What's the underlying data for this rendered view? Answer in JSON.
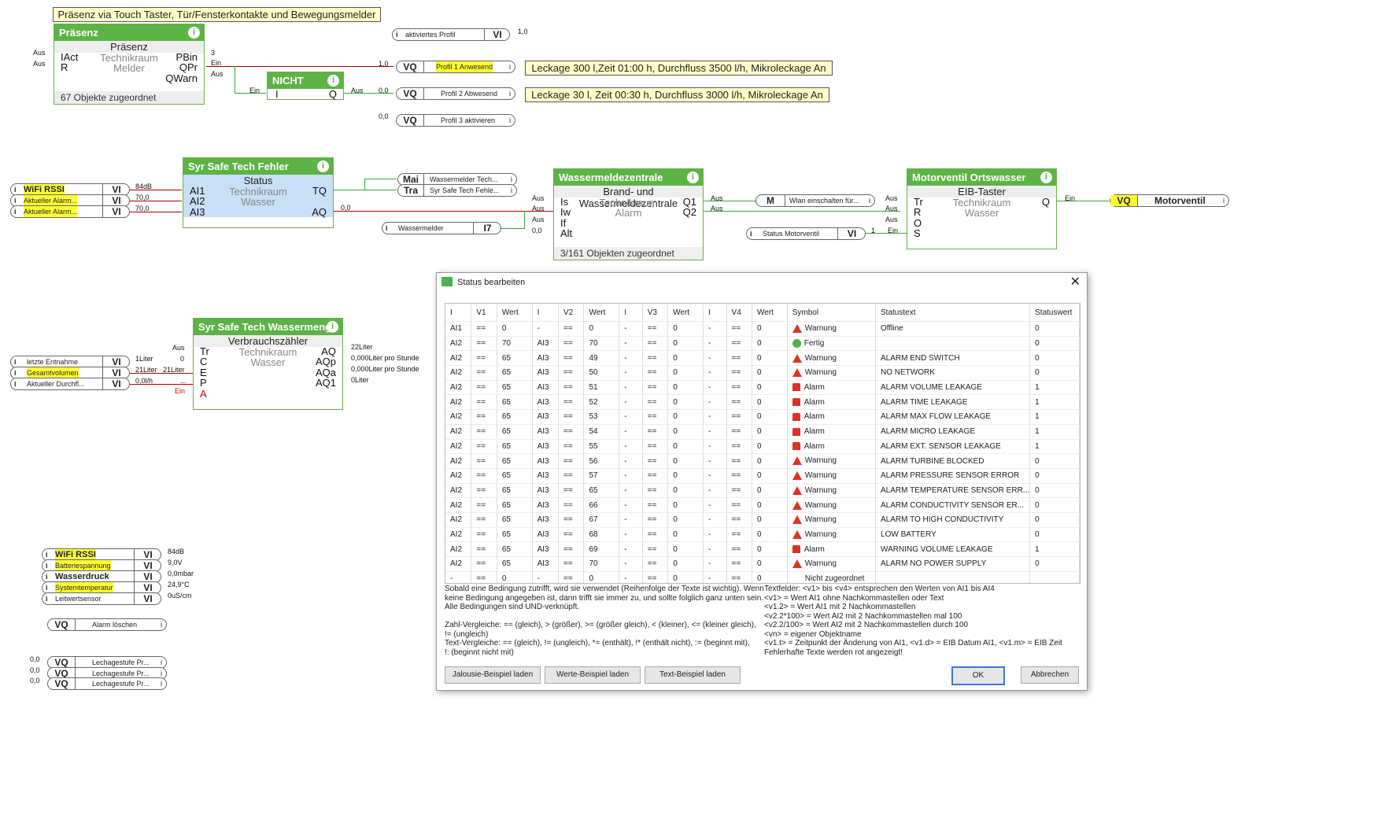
{
  "notes": {
    "top": "Präsenz via Touch Taster, Tür/Fensterkontakte und Bewegungsmelder",
    "leak1": "Leckage 300 l,Zeit 01:00 h, Durchfluss 3500 l/h, Mikroleckage An",
    "leak2": "Leckage 30 l, Zeit 00:30 h, Durchfluss 3000 l/h, Mikroleckage An"
  },
  "praesenz": {
    "title": "Präsenz",
    "sub": "Präsenz",
    "room": "Technikraum",
    "type": "Melder",
    "in1": "IAct",
    "in2": "R",
    "out1": "PBin",
    "out2": "QPr",
    "out3": "QWarn",
    "footer": "67 Objekte zugeordnet",
    "lbl_aus1": "Aus",
    "lbl_aus2": "Aus",
    "val_pbin": "3",
    "val_ein": "Ein",
    "val_aus": "Aus"
  },
  "nicht": {
    "title": "NICHT",
    "in": "I",
    "out": "Q",
    "lbl_in": "Ein",
    "lbl_out": "Aus",
    "val": "0,0"
  },
  "profiles": {
    "active": {
      "label": "aktiviertes Profil",
      "type": "VI",
      "value": "1,0"
    },
    "p1": {
      "label": "Profil 1 Anwesend",
      "type": "VQ",
      "value": "1,0"
    },
    "p2": {
      "label": "Profil 2 Abwesend",
      "type": "VQ",
      "value": "0,0"
    },
    "p3": {
      "label": "Profil 3 aktivieren",
      "type": "VQ",
      "value": "0,0"
    }
  },
  "fehler": {
    "title": "Syr Safe Tech Fehler",
    "sub": "Status",
    "room": "Technikraum",
    "type": "Wasser",
    "in1": "AI1",
    "in2": "AI2",
    "in3": "AI3",
    "out1": "TQ",
    "out2": "AQ",
    "inputs": [
      {
        "label": "WiFi RSSI",
        "type": "VI",
        "value": "84dB"
      },
      {
        "label": "Aktueller Alarm...",
        "type": "VI",
        "value": "70,0"
      },
      {
        "label": "Aktueller Alarm...",
        "type": "VI",
        "value": "70,0"
      }
    ],
    "out_val": "0,0",
    "mai": {
      "type": "Mai",
      "label": "Wassermelder Tech..."
    },
    "tra": {
      "type": "Tra",
      "label": "Syr Safe Tech Fehle..."
    },
    "wassermelder": {
      "label": "Wassermelder",
      "type": "I7"
    }
  },
  "zentrale": {
    "title": "Wassermeldezentrale",
    "sub": "Brand- und Wassermeldezentrale",
    "room": "Technikraum",
    "type": "Alarm",
    "in1": "Is",
    "in2": "Iw",
    "in3": "If",
    "in4": "Alt",
    "out1": "Q1",
    "out2": "Q2",
    "footer": "3/161 Objekten zugeordnet",
    "lbl": [
      "Aus",
      "Aus",
      "Aus",
      "0,0"
    ],
    "out_lbl": [
      "Aus",
      "Aus"
    ],
    "m": {
      "type": "M",
      "label": "Wlan einschalten für..."
    }
  },
  "motor": {
    "title": "Motorventil Ortswasser",
    "sub": "EIB-Taster",
    "room": "Technikraum",
    "type": "Wasser",
    "in1": "Tr",
    "in2": "R",
    "in3": "O",
    "in4": "S",
    "out": "Q",
    "lbl": [
      "Aus",
      "Aus",
      "Aus",
      "Ein"
    ],
    "out_lbl": "Ein",
    "status": {
      "label": "Status Motorventil",
      "type": "VI",
      "value": "1"
    },
    "vq": {
      "type": "VQ",
      "label": "Motorventil"
    }
  },
  "menge": {
    "title": "Syr Safe Tech Wassermenge",
    "sub": "Verbrauchszähler",
    "room": "Technikraum",
    "type": "Wasser",
    "in": [
      "Tr",
      "C",
      "E",
      "P",
      "A"
    ],
    "out": [
      "AQ",
      "AQp",
      "AQa",
      "AQ1"
    ],
    "out_vals": [
      "22Liter",
      "0,000Liter pro Stunde",
      "0,000Liter pro Stunde",
      "0Liter"
    ],
    "lbl_aus": "Aus",
    "lbl_ein": "Ein",
    "lbl_0": "0",
    "lbl_21": "21Liter",
    "lbl_dots": "...",
    "inputs": [
      {
        "label": "letzte Entnahme",
        "type": "VI",
        "value": "1Liter"
      },
      {
        "label": "Gesamtvolumen",
        "type": "VI",
        "value": "21Liter"
      },
      {
        "label": "Aktueller Durchfl...",
        "type": "VI",
        "value": "0,0l/h"
      }
    ]
  },
  "sensors": [
    {
      "label": "WiFi RSSI",
      "type": "VI",
      "value": "84dB"
    },
    {
      "label": "Batteriespannung",
      "type": "VI",
      "value": "9,0V"
    },
    {
      "label": "Wasserdruck",
      "type": "VI",
      "value": "0,0mbar"
    },
    {
      "label": "Systemtemperatur",
      "type": "VI",
      "value": "24,9°C"
    },
    {
      "label": "Leitwertsensor",
      "type": "VI",
      "value": "0uS/cm"
    }
  ],
  "alarm_loeschen": {
    "type": "VQ",
    "label": "Alarm löschen"
  },
  "lechage": [
    {
      "type": "VQ",
      "label": "Lechagestufe Pr...",
      "value": "0,0"
    },
    {
      "type": "VQ",
      "label": "Lechagestufe Pr...",
      "value": "0,0"
    },
    {
      "type": "VQ",
      "label": "Lechagestufe Pr...",
      "value": "0,0"
    }
  ],
  "dialog": {
    "title": "Status bearbeiten",
    "columns": [
      "I",
      "V1",
      "Wert",
      "I",
      "V2",
      "Wert",
      "I",
      "V3",
      "Wert",
      "I",
      "V4",
      "Wert",
      "Symbol",
      "Statustext",
      "Statuswert"
    ],
    "rows": [
      [
        "AI1",
        "==",
        "0",
        "-",
        "==",
        "0",
        "-",
        "==",
        "0",
        "-",
        "==",
        "0",
        "warn",
        "Warnung",
        "Offline",
        "0"
      ],
      [
        "AI2",
        "==",
        "70",
        "AI3",
        "==",
        "70",
        "-",
        "==",
        "0",
        "-",
        "==",
        "0",
        "ok",
        "Fertig",
        "",
        "0"
      ],
      [
        "AI2",
        "==",
        "65",
        "AI3",
        "==",
        "49",
        "-",
        "==",
        "0",
        "-",
        "==",
        "0",
        "warn",
        "Warnung",
        "ALARM END SWITCH",
        "0"
      ],
      [
        "AI2",
        "==",
        "65",
        "AI3",
        "==",
        "50",
        "-",
        "==",
        "0",
        "-",
        "==",
        "0",
        "warn",
        "Warnung",
        "NO NETWORK",
        "0"
      ],
      [
        "AI2",
        "==",
        "65",
        "AI3",
        "==",
        "51",
        "-",
        "==",
        "0",
        "-",
        "==",
        "0",
        "alarm",
        "Alarm",
        "ALARM VOLUME LEAKAGE",
        "1"
      ],
      [
        "AI2",
        "==",
        "65",
        "AI3",
        "==",
        "52",
        "-",
        "==",
        "0",
        "-",
        "==",
        "0",
        "alarm",
        "Alarm",
        "ALARM TIME LEAKAGE",
        "1"
      ],
      [
        "AI2",
        "==",
        "65",
        "AI3",
        "==",
        "53",
        "-",
        "==",
        "0",
        "-",
        "==",
        "0",
        "alarm",
        "Alarm",
        "ALARM MAX FLOW LEAKAGE",
        "1"
      ],
      [
        "AI2",
        "==",
        "65",
        "AI3",
        "==",
        "54",
        "-",
        "==",
        "0",
        "-",
        "==",
        "0",
        "alarm",
        "Alarm",
        "ALARM MICRO LEAKAGE",
        "1"
      ],
      [
        "AI2",
        "==",
        "65",
        "AI3",
        "==",
        "55",
        "-",
        "==",
        "0",
        "-",
        "==",
        "0",
        "alarm",
        "Alarm",
        "ALARM EXT. SENSOR LEAKAGE",
        "1"
      ],
      [
        "AI2",
        "==",
        "65",
        "AI3",
        "==",
        "56",
        "-",
        "==",
        "0",
        "-",
        "==",
        "0",
        "warn",
        "Warnung",
        "ALARM TURBINE BLOCKED",
        "0"
      ],
      [
        "AI2",
        "==",
        "65",
        "AI3",
        "==",
        "57",
        "-",
        "==",
        "0",
        "-",
        "==",
        "0",
        "warn",
        "Warnung",
        "ALARM PRESSURE SENSOR ERROR",
        "0"
      ],
      [
        "AI2",
        "==",
        "65",
        "AI3",
        "==",
        "65",
        "-",
        "==",
        "0",
        "-",
        "==",
        "0",
        "warn",
        "Warnung",
        "ALARM TEMPERATURE SENSOR ERR...",
        "0"
      ],
      [
        "AI2",
        "==",
        "65",
        "AI3",
        "==",
        "66",
        "-",
        "==",
        "0",
        "-",
        "==",
        "0",
        "warn",
        "Warnung",
        "ALARM CONDUCTIVITY SENSOR ER...",
        "0"
      ],
      [
        "AI2",
        "==",
        "65",
        "AI3",
        "==",
        "67",
        "-",
        "==",
        "0",
        "-",
        "==",
        "0",
        "warn",
        "Warnung",
        "ALARM TO HIGH CONDUCTIVITY",
        "0"
      ],
      [
        "AI2",
        "==",
        "65",
        "AI3",
        "==",
        "68",
        "-",
        "==",
        "0",
        "-",
        "==",
        "0",
        "warn",
        "Warnung",
        "LOW BATTERY",
        "0"
      ],
      [
        "AI2",
        "==",
        "65",
        "AI3",
        "==",
        "69",
        "-",
        "==",
        "0",
        "-",
        "==",
        "0",
        "alarm",
        "Alarm",
        "WARNING VOLUME LEAKAGE",
        "1"
      ],
      [
        "AI2",
        "==",
        "65",
        "AI3",
        "==",
        "70",
        "-",
        "==",
        "0",
        "-",
        "==",
        "0",
        "warn",
        "Warnung",
        "ALARM NO POWER SUPPLY",
        "0"
      ],
      [
        "-",
        "==",
        "0",
        "-",
        "==",
        "0",
        "-",
        "==",
        "0",
        "-",
        "==",
        "0",
        "none",
        "Nicht zugeordnet",
        "",
        ""
      ]
    ],
    "help_left": "Sobald eine Bedingung zutrifft, wird sie verwendet (Reihenfolge der Texte ist wichtig). Wenn\nkeine Bedingung angegeben ist, dann trifft sie immer zu, und sollte folglich ganz unten sein.\nAlle Bedingungen sind UND-verknüpft.\n\nZahl-Vergleiche: == (gleich), > (größer), >= (größer gleich), < (kleiner), <= (kleiner gleich),\n!= (ungleich)\nText-Vergleiche: == (gleich), != (ungleich), *= (enthält), !* (enthält nicht), := (beginnt mit),\n!: (beginnt nicht mit)",
    "help_right": "Textfelder: <v1> bis <v4> entsprechen den Werten von AI1 bis AI4\n<v1> = Wert AI1 ohne Nachkommastellen oder Text\n<v1.2> = Wert AI1 mit 2 Nachkommastellen\n<v2.2*100> = Wert AI2 mit 2 Nachkommastellen mal 100\n<v2.2/100> = Wert AI2 mit 2 Nachkommastellen durch 100\n<vn> = eigener Objektname\n<v1.t> = Zeitpunkt der Änderung von AI1, <v1.d> = EIB Datum AI1, <v1.m> = EIB Zeit\nFehlerhafte Texte werden rot angezeigt!",
    "buttons": {
      "jalousie": "Jalousie-Beispiel laden",
      "werte": "Werte-Beispiel laden",
      "text": "Text-Beispiel laden",
      "ok": "OK",
      "cancel": "Abbrechen"
    }
  }
}
